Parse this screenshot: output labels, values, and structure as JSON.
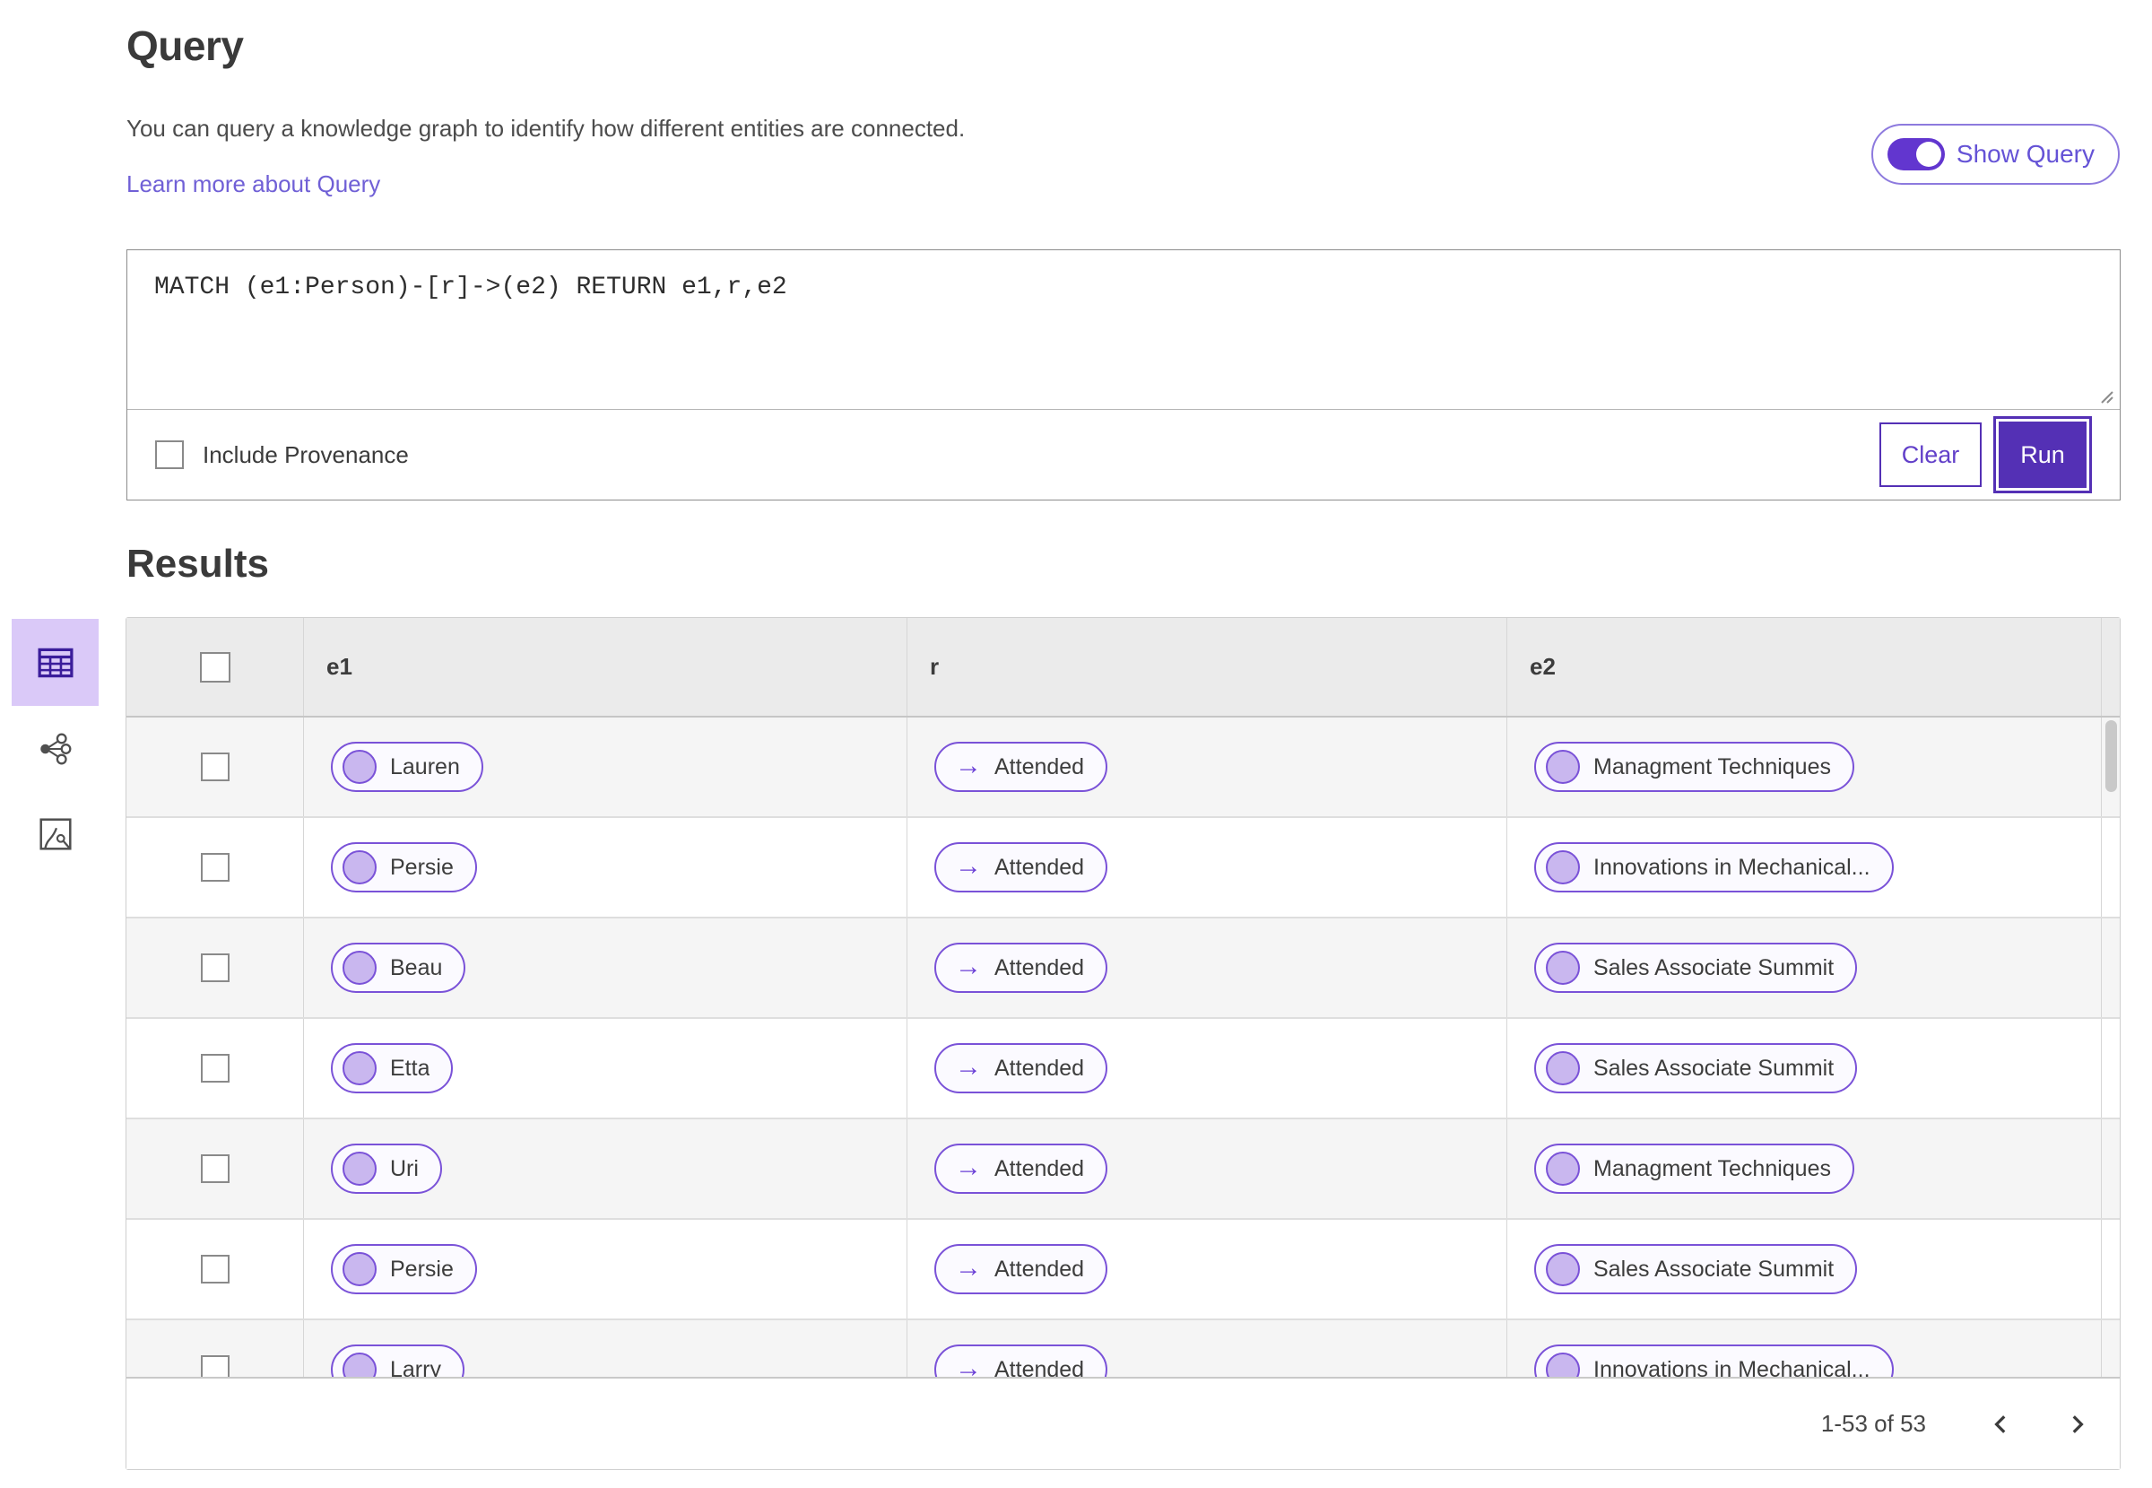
{
  "colors": {
    "accent_purple": "#5430b5",
    "pill_border_purple": "#7a52d8",
    "pill_background": "#fbfaff",
    "link_purple": "#7060d6",
    "selected_tile_background": "#dac9f8",
    "table_header_background": "#ebebeb",
    "alt_row_background": "#f5f5f5"
  },
  "icons": {
    "relation_arrow": "→"
  },
  "query_panel": {
    "title": "Query",
    "description": "You can query a knowledge graph to identify how different entities are connected.",
    "learn_more_link": "Learn more about Query",
    "show_query_label": "Show Query",
    "show_query_on": true,
    "query_text": "MATCH (e1:Person)-[r]->(e2) RETURN e1,r,e2",
    "include_provenance_label": "Include Provenance",
    "include_provenance_checked": false,
    "clear_button": "Clear",
    "run_button": "Run"
  },
  "results": {
    "title": "Results",
    "columns": [
      "e1",
      "r",
      "e2"
    ],
    "rows": [
      {
        "e1": "Lauren",
        "r": "Attended",
        "e2": "Managment Techniques"
      },
      {
        "e1": "Persie",
        "r": "Attended",
        "e2": "Innovations in Mechanical..."
      },
      {
        "e1": "Beau",
        "r": "Attended",
        "e2": "Sales Associate Summit"
      },
      {
        "e1": "Etta",
        "r": "Attended",
        "e2": "Sales Associate Summit"
      },
      {
        "e1": "Uri",
        "r": "Attended",
        "e2": "Managment Techniques"
      },
      {
        "e1": "Persie",
        "r": "Attended",
        "e2": "Sales Associate Summit"
      },
      {
        "e1": "Larry",
        "r": "Attended",
        "e2": "Innovations in Mechanical..."
      }
    ],
    "pagination": {
      "range_text": "1-53 of 53"
    }
  },
  "view_switcher": {
    "items": [
      {
        "name": "table-view",
        "selected": true
      },
      {
        "name": "network-view",
        "selected": false
      },
      {
        "name": "map-view",
        "selected": false
      }
    ]
  }
}
